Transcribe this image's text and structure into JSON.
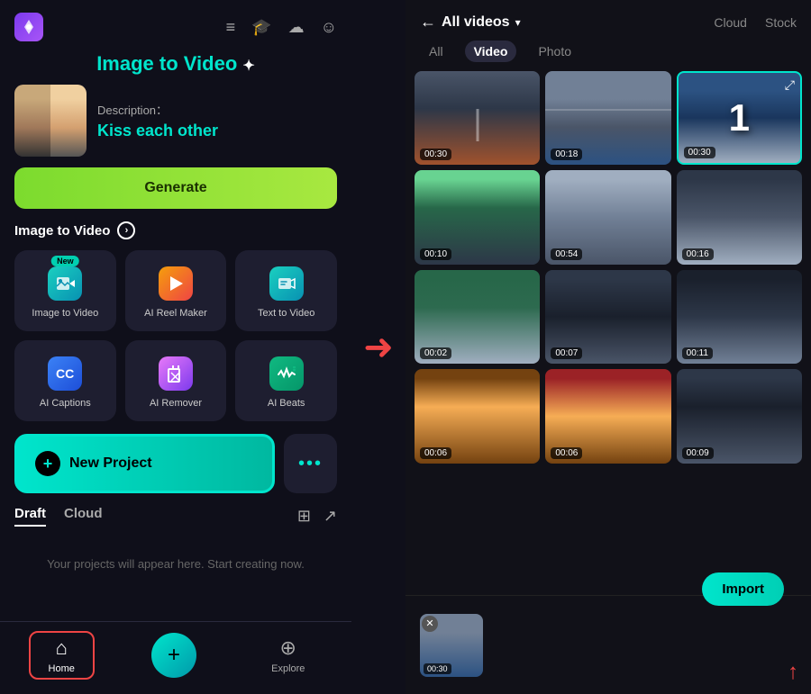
{
  "left": {
    "title": "Image to Video",
    "title_sparkle": "✦",
    "description_label": "Description：",
    "description_text": "Kiss each other",
    "generate_btn": "Generate",
    "section_title": "Image to Video",
    "tools": [
      {
        "id": "img-to-video",
        "label": "Image to Video",
        "icon": "▶",
        "badge": "New"
      },
      {
        "id": "ai-reel",
        "label": "AI Reel Maker",
        "icon": "⚡",
        "badge": ""
      },
      {
        "id": "text-to-video",
        "label": "Text to Video",
        "icon": "✏",
        "badge": ""
      },
      {
        "id": "ai-captions",
        "label": "AI Captions",
        "icon": "CC",
        "badge": ""
      },
      {
        "id": "ai-remover",
        "label": "AI Remover",
        "icon": "◈",
        "badge": ""
      },
      {
        "id": "ai-beats",
        "label": "AI Beats",
        "icon": "♬",
        "badge": ""
      }
    ],
    "new_project_label": "New Project",
    "more_dots": "•••",
    "tabs": [
      {
        "id": "draft",
        "label": "Draft",
        "active": true
      },
      {
        "id": "cloud",
        "label": "Cloud",
        "active": false
      }
    ],
    "empty_state": "Your projects will appear here. Start creating now.",
    "nav": [
      {
        "id": "home",
        "label": "Home",
        "icon": "⌂",
        "active": true
      },
      {
        "id": "plus",
        "label": "",
        "icon": "+",
        "center": true
      },
      {
        "id": "explore",
        "label": "Explore",
        "icon": "⊕",
        "active": false
      }
    ]
  },
  "right": {
    "back_label": "←",
    "all_videos_label": "All videos",
    "dropdown_icon": "▾",
    "top_tabs": [
      {
        "id": "cloud",
        "label": "Cloud",
        "active": false
      },
      {
        "id": "stock",
        "label": "Stock",
        "active": false
      }
    ],
    "filter_tabs": [
      {
        "id": "all",
        "label": "All",
        "active": false
      },
      {
        "id": "video",
        "label": "Video",
        "active": true
      },
      {
        "id": "photo",
        "label": "Photo",
        "active": false
      }
    ],
    "videos": [
      {
        "id": 1,
        "duration": "00:30",
        "class": "vt-1",
        "selected": false
      },
      {
        "id": 2,
        "duration": "00:18",
        "class": "vt-2",
        "selected": false
      },
      {
        "id": 3,
        "duration": "00:30",
        "class": "vt-3",
        "selected": true,
        "number": "1"
      },
      {
        "id": 4,
        "duration": "00:10",
        "class": "vt-4",
        "selected": false
      },
      {
        "id": 5,
        "duration": "00:54",
        "class": "vt-5",
        "selected": false
      },
      {
        "id": 6,
        "duration": "00:16",
        "class": "vt-6",
        "selected": false
      },
      {
        "id": 7,
        "duration": "00:02",
        "class": "vt-7",
        "selected": false
      },
      {
        "id": 8,
        "duration": "00:07",
        "class": "vt-8",
        "selected": false
      },
      {
        "id": 9,
        "duration": "00:11",
        "class": "vt-9",
        "selected": false
      },
      {
        "id": 10,
        "duration": "00:06",
        "class": "vt-10",
        "selected": false
      },
      {
        "id": 11,
        "duration": "00:06",
        "class": "vt-11",
        "selected": false
      },
      {
        "id": 12,
        "duration": "00:09",
        "class": "vt-12",
        "selected": false
      }
    ],
    "import_btn": "Import",
    "preview_duration": "00:30"
  }
}
